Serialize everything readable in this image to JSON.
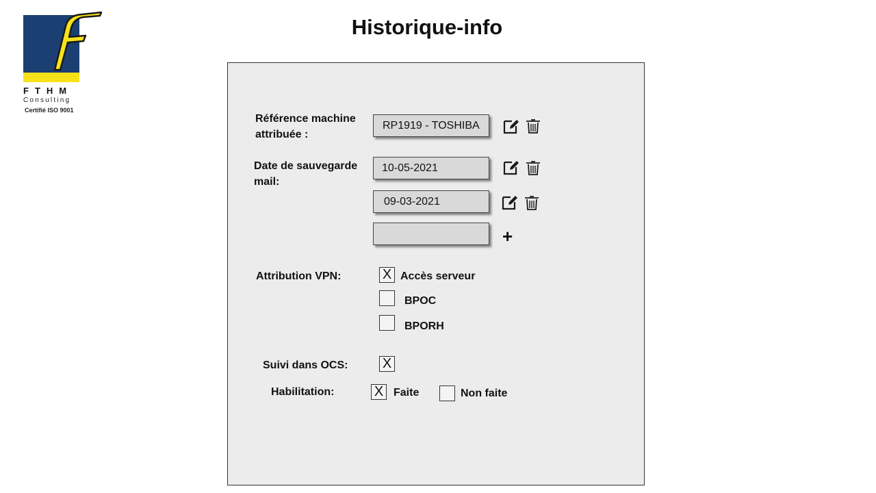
{
  "logo": {
    "name": "FTHM",
    "subtitle": "Consulting",
    "certification": "Certifié ISO 9001"
  },
  "page": {
    "title": "Historique-info"
  },
  "reference": {
    "label": "Référence machine attribuée :",
    "value": "RP1919 - TOSHIBA"
  },
  "backup": {
    "label": "Date de sauvegarde mail:",
    "dates": [
      "10-05-2021",
      "09-03-2021"
    ],
    "new_value": "",
    "add_label": "+"
  },
  "vpn": {
    "label": "Attribution VPN:",
    "options": [
      {
        "label": "Accès serveur",
        "checked": true,
        "mark": "X"
      },
      {
        "label": "BPOC",
        "checked": false,
        "mark": ""
      },
      {
        "label": "BPORH",
        "checked": false,
        "mark": ""
      }
    ]
  },
  "ocs": {
    "label": "Suivi dans OCS:",
    "checked": true,
    "mark": "X"
  },
  "habilitation": {
    "label": "Habilitation:",
    "done": {
      "label": "Faite",
      "checked": true,
      "mark": "X"
    },
    "not_done": {
      "label": "Non faite",
      "checked": false,
      "mark": ""
    }
  },
  "colors": {
    "logo_blue": "#1b3f73",
    "logo_yellow": "#f7e21a",
    "panel_bg": "#ececec",
    "field_bg": "#d9d9d9"
  },
  "icons": [
    "edit-icon",
    "trash-icon",
    "plus-icon"
  ]
}
